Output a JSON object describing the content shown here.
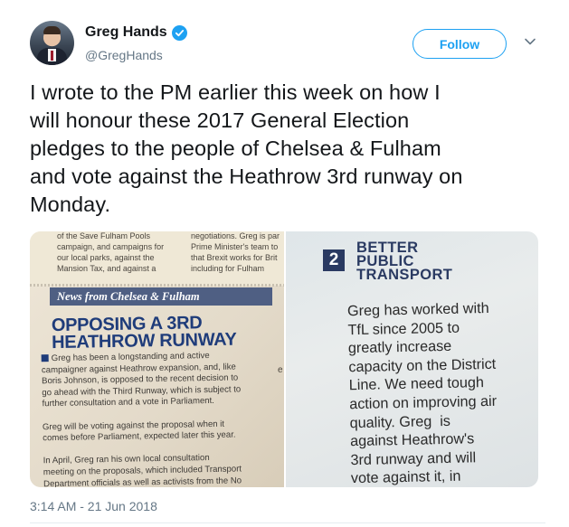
{
  "user": {
    "display_name": "Greg Hands",
    "handle": "@GregHands",
    "verified": true,
    "avatar_icon": "profile-photo"
  },
  "actions": {
    "follow_label": "Follow",
    "caret_icon": "chevron-down-icon"
  },
  "tweet": {
    "text": "I wrote to the PM earlier this week on how I\nwill honour these 2017 General Election\npledges to the people of Chelsea & Fulham\nand vote against the Heathrow 3rd runway on\nMonday.",
    "timestamp": "3:14 AM - 21 Jun 2018"
  },
  "media": {
    "left": {
      "col1_text": "of the Save Fulham Pools\ncampaign, and campaigns for\nour local parks, against the\nMansion Tax, and against a",
      "col2_text": "negotiations. Greg is par\nPrime Minister's team to\nthat Brexit works for Brit\nincluding for Fulham",
      "banner": "News from Chelsea & Fulham",
      "heading": "OPPOSING A 3RD\nHEATHROW RUNWAY",
      "body": "Greg has been a longstanding and active\ncampaigner against Heathrow expansion, and, like\nBoris Johnson, is opposed to the recent decision to\ngo ahead with the Third Runway, which is subject to\nfurther consultation and a vote in Parliament.\n\nGreg will be voting against the proposal when it\ncomes before Parliament, expected later this year.\n\nIn April, Greg ran his own local consultation\nmeeting on the proposals, which included Transport\nDepartment officials as well as activists from the No\nThird Runway group. The meeting saw a big turnout",
      "edge_char": "e"
    },
    "right": {
      "number": "2",
      "title": "BETTER\nPUBLIC\nTRANSPORT",
      "body": "Greg has worked with\nTfL since 2005 to\ngreatly increase\ncapacity on the District\nLine. We need tough\naction on improving air\nquality. Greg  is\nagainst Heathrow's\n3rd runway and will\nvote against it, in"
    }
  },
  "colors": {
    "accent": "#1da1f2",
    "text_primary": "#14171a",
    "text_secondary": "#657786",
    "leaflet_navy": "#1f3c7a"
  }
}
